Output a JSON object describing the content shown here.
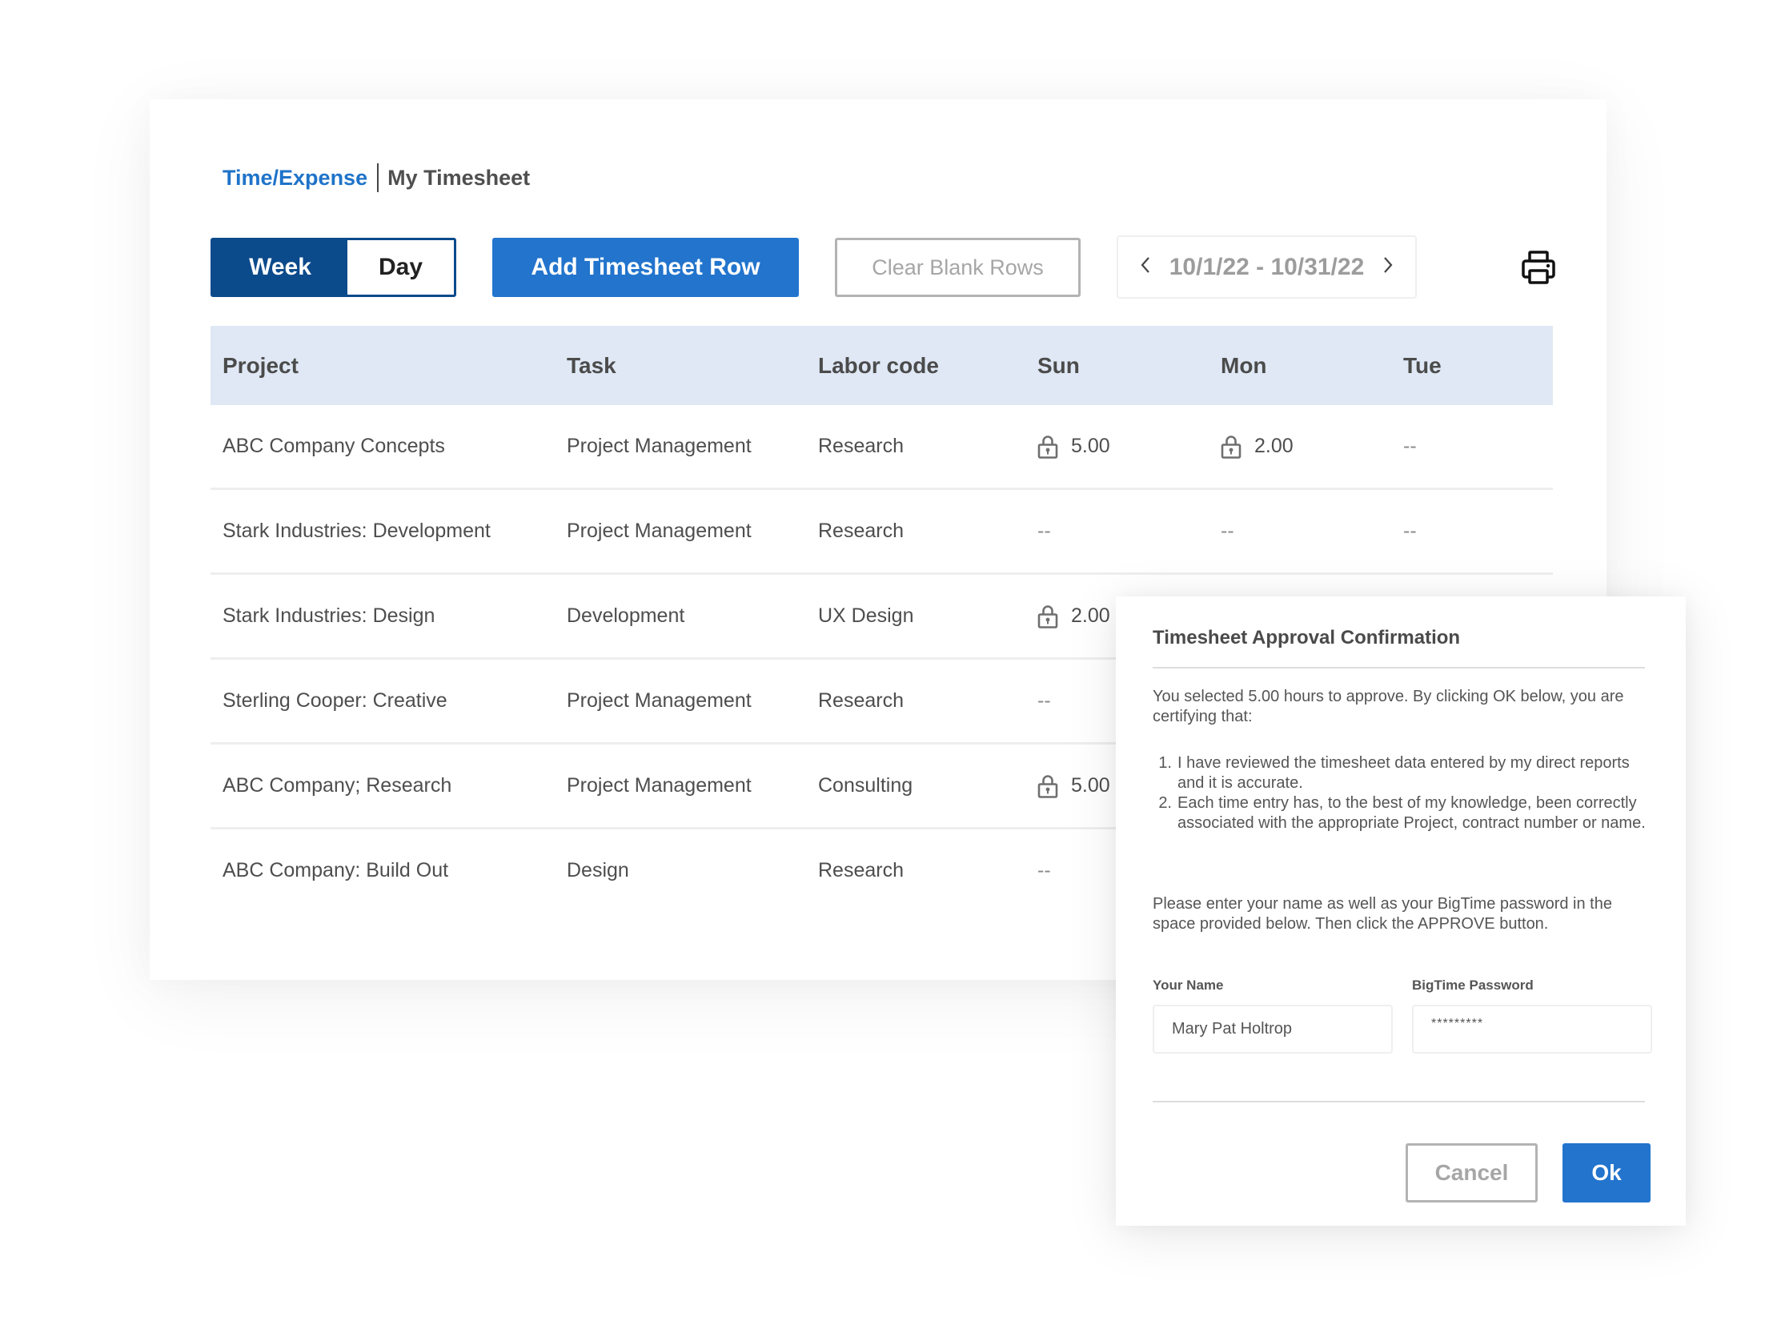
{
  "breadcrumb": {
    "section": "Time/Expense",
    "current": "My Timesheet"
  },
  "toolbar": {
    "view_toggle": {
      "options": [
        "Week",
        "Day"
      ],
      "selected": "Week"
    },
    "add_row_label": "Add Timesheet Row",
    "clear_blank_label": "Clear Blank Rows",
    "date_range": "10/1/22 - 10/31/22",
    "prev_icon": "chevron-left-icon",
    "next_icon": "chevron-right-icon",
    "print_icon": "printer-icon"
  },
  "table": {
    "columns": [
      "Project",
      "Task",
      "Labor code",
      "Sun",
      "Mon",
      "Tue"
    ],
    "rows": [
      {
        "project": "ABC Company Concepts",
        "task": "Project Management",
        "labor_code": "Research",
        "sun": {
          "value": "5.00",
          "locked": true
        },
        "mon": {
          "value": "2.00",
          "locked": true
        },
        "tue": {
          "value": "--",
          "locked": false
        }
      },
      {
        "project": "Stark Industries: Development",
        "task": "Project Management",
        "labor_code": "Research",
        "sun": {
          "value": "--",
          "locked": false
        },
        "mon": {
          "value": "--",
          "locked": false
        },
        "tue": {
          "value": "--",
          "locked": false
        }
      },
      {
        "project": "Stark Industries: Design",
        "task": "Development",
        "labor_code": "UX Design",
        "sun": {
          "value": "2.00",
          "locked": true
        }
      },
      {
        "project": "Sterling Cooper: Creative",
        "task": "Project Management",
        "labor_code": "Research",
        "sun": {
          "value": "--",
          "locked": false
        }
      },
      {
        "project": "ABC Company; Research",
        "task": "Project Management",
        "labor_code": "Consulting",
        "sun": {
          "value": "5.00",
          "locked": true
        }
      },
      {
        "project": "ABC Company:  Build Out",
        "task": "Design",
        "labor_code": "Research",
        "sun": {
          "value": "--",
          "locked": false
        }
      }
    ]
  },
  "dialog": {
    "title": "Timesheet Approval Confirmation",
    "intro": "You selected 5.00 hours to approve. By clicking OK below, you are certifying that:",
    "items": [
      {
        "num": "1.",
        "text": "I have reviewed the timesheet data entered by my direct reports and it is accurate."
      },
      {
        "num": "2.",
        "text": "Each time entry has, to the best of my knowledge, been correctly associated with the appropriate Project, contract number or name."
      }
    ],
    "instructions": "Please enter your name as well as your BigTime password in the space provided below. Then click the APPROVE button.",
    "name_label": "Your Name",
    "name_value": "Mary Pat Holtrop",
    "password_label": "BigTime Password",
    "password_value": "*********",
    "cancel_label": "Cancel",
    "ok_label": "Ok"
  },
  "colors": {
    "brand_blue": "#2274cd",
    "dark_blue": "#0b4a8b",
    "header_bg": "#dfe8f4",
    "muted_gray": "#a6a6a6"
  }
}
